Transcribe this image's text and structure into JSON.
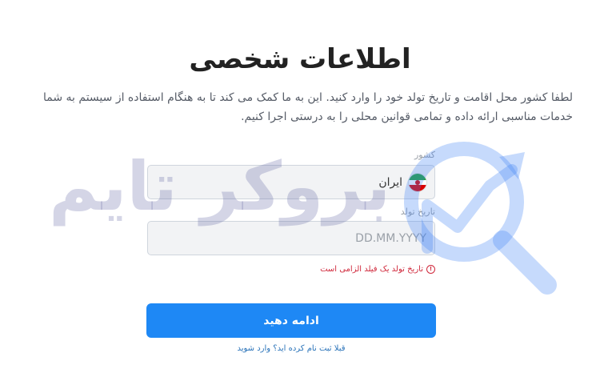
{
  "page": {
    "title": "اطلاعات شخصی",
    "description": "لطفا کشور محل اقامت و تاریخ تولد خود را وارد کنید. این به ما کمک می کند تا به هنگام استفاده از سیستم به شما خدمات مناسبی ارائه داده و تمامی قوانین محلی را به درستی اجرا کنیم."
  },
  "form": {
    "country_label": "کشور",
    "country_value": "ایران",
    "country_flag_icon": "iran-flag-icon",
    "dob_label": "تاریخ تولد",
    "dob_value": "",
    "dob_placeholder": "DD.MM.YYYY",
    "error_icon": "!",
    "error_text": "تاریخ تولد یک فیلد الزامی است",
    "submit_label": "ادامه دهید",
    "login_link": "قبلا ثبت نام کرده اید؟ وارد شوید"
  },
  "watermark": {
    "text": "بروکر تایم",
    "logo_icon": "magnifier-chart-logo"
  },
  "colors": {
    "primary": "#1e88f5",
    "error": "#d0283b",
    "link": "#2a73b9",
    "field_bg": "#f2f3f5",
    "watermark": "#585ea0"
  }
}
